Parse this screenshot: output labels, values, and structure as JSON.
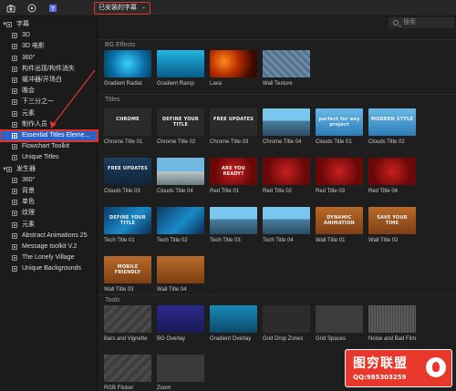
{
  "toolbar": {
    "filter_label": "已安装的字幕",
    "filter_chevron": "⌄",
    "icons": [
      "photos-icon",
      "music-icon",
      "titles-icon"
    ]
  },
  "search": {
    "placeholder": "搜索"
  },
  "sidebar": {
    "items": [
      {
        "label": "字幕",
        "kind": "group",
        "expanded": true
      },
      {
        "label": "3D",
        "kind": "item"
      },
      {
        "label": "3D 电影",
        "kind": "item"
      },
      {
        "label": "360°",
        "kind": "item"
      },
      {
        "label": "构件出现/构件消失",
        "kind": "item"
      },
      {
        "label": "缓冲器/开场白",
        "kind": "item"
      },
      {
        "label": "晚会",
        "kind": "item"
      },
      {
        "label": "下三分之一",
        "kind": "item"
      },
      {
        "label": "元素",
        "kind": "item"
      },
      {
        "label": "制作人员",
        "kind": "item"
      },
      {
        "label": "Essential Titles Eleme...",
        "kind": "item",
        "selected": true
      },
      {
        "label": "Flowchart Toolkit",
        "kind": "item"
      },
      {
        "label": "Unique Titles",
        "kind": "item"
      },
      {
        "label": "发生器",
        "kind": "group",
        "expanded": true
      },
      {
        "label": "360°",
        "kind": "item"
      },
      {
        "label": "背景",
        "kind": "item"
      },
      {
        "label": "单色",
        "kind": "item"
      },
      {
        "label": "纹理",
        "kind": "item"
      },
      {
        "label": "元素",
        "kind": "item"
      },
      {
        "label": "Abstract Animations 25",
        "kind": "item"
      },
      {
        "label": "Message toolkit V.2",
        "kind": "item"
      },
      {
        "label": "The Lonely Village",
        "kind": "item"
      },
      {
        "label": "Unique Backgrounds",
        "kind": "item"
      }
    ]
  },
  "sections": {
    "bg_effects": {
      "heading": "BG Effects",
      "tiles": [
        {
          "name": "Gradient Radial",
          "thumb_text": ""
        },
        {
          "name": "Gradient Ramp",
          "thumb_text": ""
        },
        {
          "name": "Lava",
          "thumb_text": ""
        },
        {
          "name": "Wall Texture",
          "thumb_text": ""
        }
      ]
    },
    "titles": {
      "heading": "Titles",
      "tiles": [
        {
          "name": "Chrome Title 01",
          "thumb_text": "CHROME"
        },
        {
          "name": "Chrome Title 02",
          "thumb_text": "DEFINE YOUR TITLE"
        },
        {
          "name": "Chrome Title 03",
          "thumb_text": "FREE UPDATES"
        },
        {
          "name": "Chrome Title 04",
          "thumb_text": ""
        },
        {
          "name": "Clouds Title 01",
          "thumb_text": "perfect for any project"
        },
        {
          "name": "Clouds Title 02",
          "thumb_text": "MODERN STYLE"
        },
        {
          "name": "Clouds Title 03",
          "thumb_text": "FREE UPDATES"
        },
        {
          "name": "Clouds Title 04",
          "thumb_text": ""
        },
        {
          "name": "Red Title 01",
          "thumb_text": "ARE YOU READY?"
        },
        {
          "name": "Red Title 02",
          "thumb_text": ""
        },
        {
          "name": "Red Title 03",
          "thumb_text": ""
        },
        {
          "name": "Red Title 04",
          "thumb_text": ""
        },
        {
          "name": "Tech Title 01",
          "thumb_text": "DEFINE YOUR TITLE"
        },
        {
          "name": "Tech Title 02",
          "thumb_text": ""
        },
        {
          "name": "Tech Title 03",
          "thumb_text": ""
        },
        {
          "name": "Tech Title 04",
          "thumb_text": ""
        },
        {
          "name": "Wall Title 01",
          "thumb_text": "DYNAMIC ANIMATION"
        },
        {
          "name": "Wall Title 02",
          "thumb_text": "SAVE YOUR TIME"
        },
        {
          "name": "Wall Title 03",
          "thumb_text": "MOBILE FRIENDLY"
        },
        {
          "name": "Wall Title 04",
          "thumb_text": ""
        }
      ]
    },
    "tools": {
      "heading": "Tools",
      "tiles": [
        {
          "name": "Bars and Vignette",
          "thumb_text": ""
        },
        {
          "name": "BG Overlay",
          "thumb_text": ""
        },
        {
          "name": "Gradient Overlay",
          "thumb_text": ""
        },
        {
          "name": "Grid Drop Zones",
          "thumb_text": ""
        },
        {
          "name": "Grid Spaces",
          "thumb_text": ""
        },
        {
          "name": "Noise and Bad Film",
          "thumb_text": ""
        },
        {
          "name": "RGB Flicker",
          "thumb_text": ""
        },
        {
          "name": "Zoom",
          "thumb_text": ""
        }
      ]
    }
  },
  "watermark": {
    "brand": "图穷联盟",
    "qq": "QQ:985303259"
  },
  "colors": {
    "selection": "#2d63c7",
    "annotation_red": "#e0332d",
    "watermark_red": "#e8372b"
  }
}
